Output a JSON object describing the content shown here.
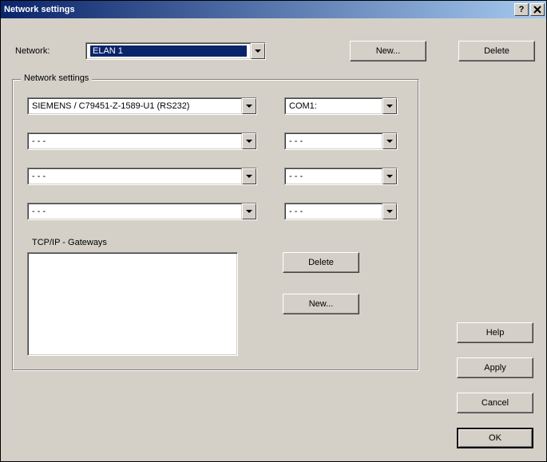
{
  "titlebar": {
    "title": "Network settings"
  },
  "top": {
    "network_label": "Network:",
    "network_value": "ELAN 1",
    "new_btn": "New...",
    "delete_btn": "Delete"
  },
  "fieldset": {
    "legend": "Network settings",
    "rows": [
      {
        "device": "SIEMENS / C79451-Z-1589-U1 (RS232)",
        "port": "COM1:"
      },
      {
        "device": "- - -",
        "port": "- - -"
      },
      {
        "device": "- - -",
        "port": "- - -"
      },
      {
        "device": "- - -",
        "port": "- - -"
      }
    ],
    "gateways_label": "TCP/IP - Gateways",
    "gw_delete": "Delete",
    "gw_new": "New..."
  },
  "buttons": {
    "help": "Help",
    "apply": "Apply",
    "cancel": "Cancel",
    "ok": "OK"
  }
}
